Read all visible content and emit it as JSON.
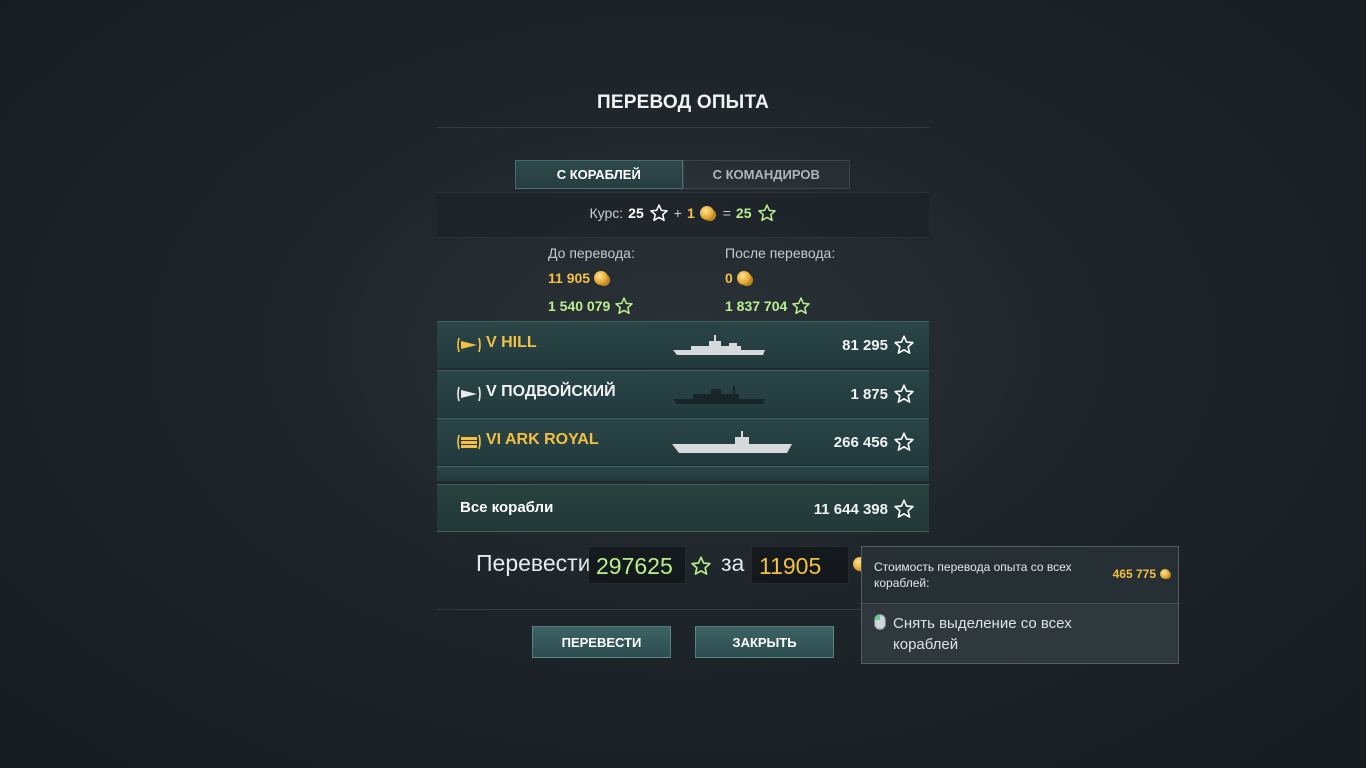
{
  "dialog": {
    "title": "ПЕРЕВОД ОПЫТА",
    "tabs": [
      {
        "label": "С КОРАБЛЕЙ",
        "active": true
      },
      {
        "label": "С КОМАНДИРОВ",
        "active": false
      }
    ],
    "rate": {
      "label": "Курс:",
      "xp_amount": "25",
      "plus": "+",
      "gold_amount": "1",
      "equals": "=",
      "free_xp_amount": "25"
    },
    "before": {
      "label": "До перевода:",
      "gold": "11 905",
      "free_xp": "1 540 079"
    },
    "after": {
      "label": "После перевода:",
      "gold": "0",
      "free_xp": "1 837 704"
    },
    "ships": [
      {
        "name": "V HILL",
        "xp": "81 295",
        "premium": true,
        "emblem": "destroyer-emblem-icon"
      },
      {
        "name": "V ПОДВОЙСКИЙ",
        "xp": "1 875",
        "premium": false,
        "emblem": "destroyer-emblem-icon"
      },
      {
        "name": "VI ARK ROYAL",
        "xp": "266 456",
        "premium": true,
        "emblem": "carrier-emblem-icon"
      }
    ],
    "all_ships": {
      "label": "Все корабли",
      "xp": "11 644 398"
    },
    "transfer": {
      "label": "Перевести",
      "xp_value": "297625",
      "for_label": "за",
      "gold_value": "11905"
    },
    "buttons": {
      "transfer": "ПЕРЕВЕСТИ",
      "close": "ЗАКРЫТЬ"
    }
  },
  "tooltip": {
    "cost_label": "Стоимость перевода опыта со всех кораблей:",
    "cost_value": "465 775",
    "hint_icon": "mouse-icon",
    "hint": "Снять выделение со всех кораблей"
  },
  "colors": {
    "gold": "#f3c044",
    "free_xp": "#b9ef8e",
    "accent": "#2c4d4f"
  }
}
